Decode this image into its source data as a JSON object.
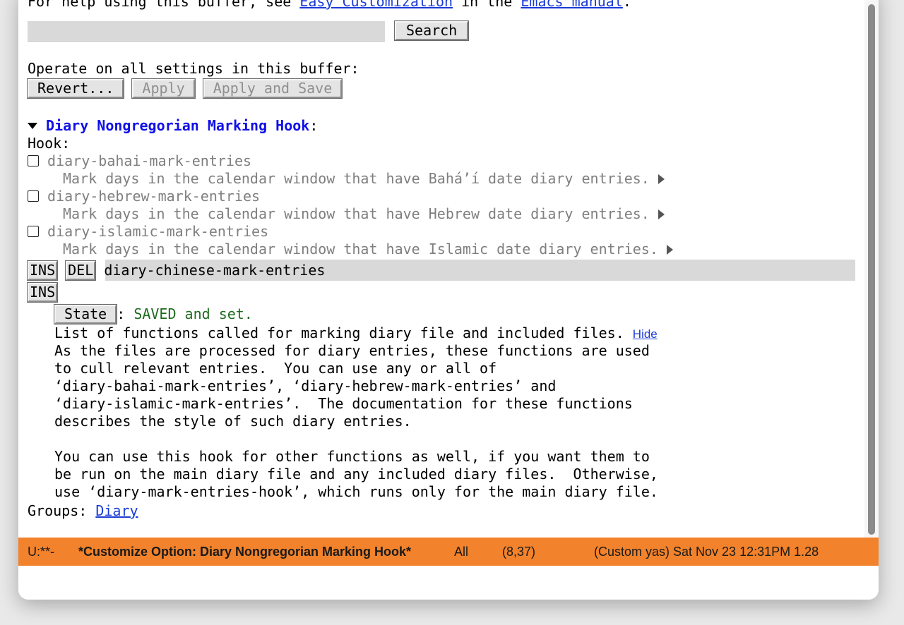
{
  "intro": {
    "prefix": "For help using this buffer, see ",
    "link1": "Easy Customization",
    "middle": " in the ",
    "link2": "Emacs manual",
    "suffix": "."
  },
  "search": {
    "value": "",
    "button": "Search"
  },
  "operate": {
    "label": "Operate on all settings in this buffer:",
    "revert": "Revert...",
    "apply": "Apply",
    "apply_save": "Apply and Save"
  },
  "option": {
    "title": "Diary Nongregorian Marking Hook",
    "colon": ":",
    "hook_label": "Hook:",
    "entries": [
      {
        "name": "diary-bahai-mark-entries",
        "doc": "Mark days in the calendar window that have Bahá’í date diary entries."
      },
      {
        "name": "diary-hebrew-mark-entries",
        "doc": "Mark days in the calendar window that have Hebrew date diary entries."
      },
      {
        "name": "diary-islamic-mark-entries",
        "doc": "Mark days in the calendar window that have Islamic date diary entries."
      }
    ],
    "ins": "INS",
    "del": "DEL",
    "value": "diary-chinese-mark-entries",
    "state_button": "State",
    "state_sep": ":",
    "state_text": "SAVED and set.",
    "doc_first": "List of functions called for marking diary file and included files.",
    "hide": "Hide",
    "doc_lines": [
      "As the files are processed for diary entries, these functions are used",
      "to cull relevant entries.  You can use any or all of",
      "‘diary-bahai-mark-entries’, ‘diary-hebrew-mark-entries’ and",
      "‘diary-islamic-mark-entries’.  The documentation for these functions",
      "describes the style of such diary entries.",
      "",
      "You can use this hook for other functions as well, if you want them to",
      "be run on the main diary file and any included diary files.  Otherwise,",
      "use ‘diary-mark-entries-hook’, which runs only for the main diary file."
    ],
    "groups_label": "Groups: ",
    "group_link": "Diary"
  },
  "modeline": {
    "status": "U:**-",
    "buffer": "*Customize Option: Diary Nongregorian Marking Hook*",
    "position": "All",
    "linecol": "(8,37)",
    "modes": "(Custom yas) Sat Nov 23 12:31PM 1.28",
    "color": "#f2822b"
  }
}
